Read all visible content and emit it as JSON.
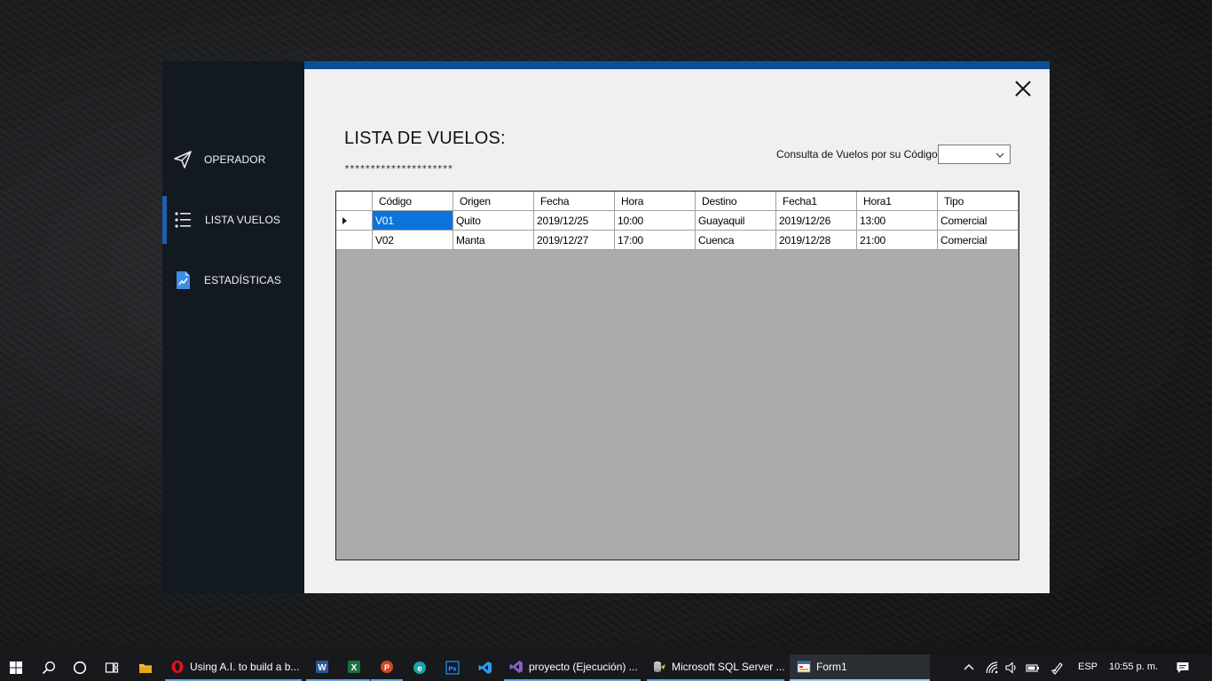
{
  "window": {
    "sidebar": {
      "items": [
        {
          "label": "OPERADOR",
          "icon": "paper-plane-icon",
          "active": false
        },
        {
          "label": "LISTA VUELOS",
          "icon": "list-icon",
          "active": true
        },
        {
          "label": "ESTADÍSTICAS",
          "icon": "stats-document-icon",
          "active": false
        }
      ]
    },
    "title": "LISTA DE VUELOS:",
    "title_decoration": "*********************",
    "query": {
      "label": "Consulta de Vuelos por su Código:",
      "selected_value": ""
    },
    "grid": {
      "columns": [
        "Código",
        "Origen",
        "Fecha",
        "Hora",
        "Destino",
        "Fecha1",
        "Hora1",
        "Tipo"
      ],
      "rows": [
        [
          "V01",
          "Quito",
          "2019/12/25",
          "10:00",
          "Guayaquil",
          "2019/12/26",
          "13:00",
          "Comercial"
        ],
        [
          "V02",
          "Manta",
          "2019/12/27",
          "17:00",
          "Cuenca",
          "2019/12/28",
          "21:00",
          "Comercial"
        ]
      ],
      "selected_row": 0,
      "selected_column": 0
    }
  },
  "colors": {
    "sidebar_bg": "#131921",
    "accent": "#0b4f98",
    "selection": "#0a74da",
    "panel_bg": "#f0f0f0"
  },
  "taskbar": {
    "apps": [
      {
        "label": "Using A.I. to build a b...",
        "icon": "opera-icon"
      },
      {
        "label": "",
        "icon": "word-icon"
      },
      {
        "label": "",
        "icon": "excel-icon"
      },
      {
        "label": "",
        "icon": "powerpoint-icon"
      },
      {
        "label": "",
        "icon": "edge-icon"
      },
      {
        "label": "",
        "icon": "photoshop-icon"
      },
      {
        "label": "",
        "icon": "vscode-icon"
      },
      {
        "label": "proyecto (Ejecución) ...",
        "icon": "visual-studio-icon"
      },
      {
        "label": "Microsoft SQL Server ...",
        "icon": "sql-server-icon"
      },
      {
        "label": "Form1",
        "icon": "form-icon"
      }
    ],
    "tray": {
      "language": "ESP",
      "time": "10:55 p. m."
    }
  }
}
